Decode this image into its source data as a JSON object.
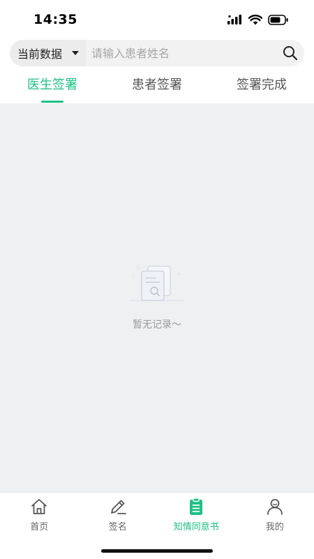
{
  "status_bar": {
    "time": "14:35"
  },
  "search": {
    "filter_label": "当前数据",
    "placeholder": "请输入患者姓名",
    "value": ""
  },
  "tabs": [
    {
      "label": "医生签署",
      "active": true
    },
    {
      "label": "患者签署",
      "active": false
    },
    {
      "label": "签署完成",
      "active": false
    }
  ],
  "empty_state": {
    "text": "暂无记录～"
  },
  "bottom_nav": [
    {
      "label": "首页",
      "icon": "home-icon",
      "active": false
    },
    {
      "label": "签名",
      "icon": "pen-icon",
      "active": false
    },
    {
      "label": "知情同意书",
      "icon": "clipboard-icon",
      "active": true
    },
    {
      "label": "我的",
      "icon": "user-icon",
      "active": false
    }
  ],
  "colors": {
    "accent": "#1fc084",
    "background": "#eff0f2"
  }
}
